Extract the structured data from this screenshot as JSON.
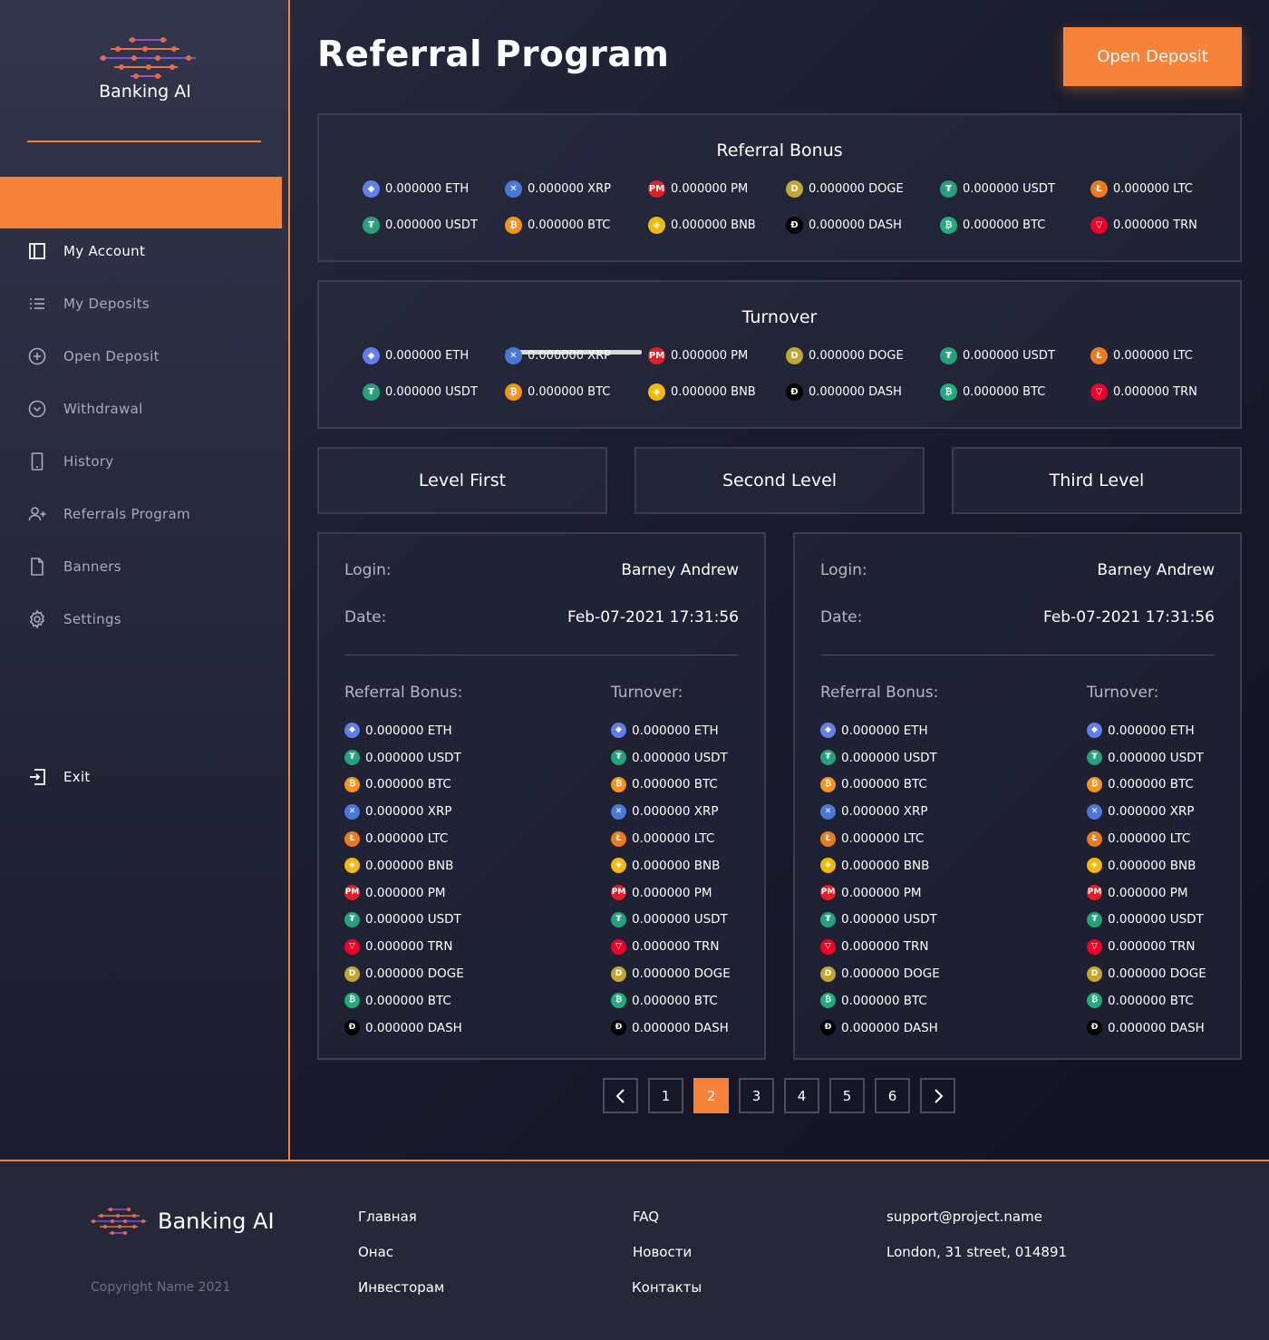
{
  "brand": {
    "name": "Banking AI"
  },
  "sidebar": {
    "items": [
      {
        "label": "My Account",
        "icon": "account-panel-icon"
      },
      {
        "label": "My Deposits",
        "icon": "list-icon"
      },
      {
        "label": "Open Deposit",
        "icon": "plus-circle-icon"
      },
      {
        "label": "Withdrawal",
        "icon": "chevron-circle-icon"
      },
      {
        "label": "History",
        "icon": "phone-icon"
      },
      {
        "label": "Referrals Program",
        "icon": "add-user-icon"
      },
      {
        "label": "Banners",
        "icon": "document-icon"
      },
      {
        "label": "Settings",
        "icon": "gear-icon"
      }
    ],
    "exit": {
      "label": "Exit",
      "icon": "exit-icon"
    }
  },
  "header": {
    "title": "Referral Program",
    "open_deposit": "Open Deposit"
  },
  "colors": {
    "accent": "#f7823a",
    "background": "#191b2c",
    "panel_border": "#3b3d52"
  },
  "coins": {
    "ETH": {
      "bg": "#627eea",
      "glyph": "◆"
    },
    "XRP": {
      "bg": "#4a78d6",
      "glyph": "✕"
    },
    "PM": {
      "bg": "#e21e26",
      "glyph": "PM"
    },
    "DOGE": {
      "bg": "#c3a634",
      "glyph": "D"
    },
    "USDT": {
      "bg": "#26a17b",
      "glyph": "₮"
    },
    "LTC": {
      "bg": "#ee7b1a",
      "glyph": "Ł"
    },
    "BTC": {
      "bg": "#f7931a",
      "glyph": "₿"
    },
    "BNB": {
      "bg": "#f0b90b",
      "glyph": "◈"
    },
    "DASH": {
      "bg": "#000000",
      "glyph": "Đ"
    },
    "BTCG": {
      "bg": "#1fae7a",
      "glyph": "₿"
    },
    "TRN": {
      "bg": "#ef0027",
      "glyph": "▽"
    }
  },
  "referral_bonus": {
    "title": "Referral Bonus",
    "rows": [
      [
        {
          "c": "ETH",
          "t": "0.000000 ETH"
        },
        {
          "c": "XRP",
          "t": "0.000000 XRP"
        },
        {
          "c": "PM",
          "t": "0.000000 PM"
        },
        {
          "c": "DOGE",
          "t": "0.000000 DOGE"
        },
        {
          "c": "USDT",
          "t": "0.000000 USDT"
        },
        {
          "c": "LTC",
          "t": "0.000000 LTC"
        }
      ],
      [
        {
          "c": "USDT",
          "t": "0.000000 USDT"
        },
        {
          "c": "BTC",
          "t": "0.000000 BTC"
        },
        {
          "c": "BNB",
          "t": "0.000000 BNB"
        },
        {
          "c": "DASH",
          "t": "0.000000 DASH"
        },
        {
          "c": "BTCG",
          "t": "0.000000 BTC"
        },
        {
          "c": "TRN",
          "t": "0.000000 TRN"
        }
      ]
    ]
  },
  "turnover": {
    "title": "Turnover",
    "rows": [
      [
        {
          "c": "ETH",
          "t": "0.000000 ETH"
        },
        {
          "c": "XRP",
          "t": "0.000000 XRP"
        },
        {
          "c": "PM",
          "t": "0.000000 PM"
        },
        {
          "c": "DOGE",
          "t": "0.000000 DOGE"
        },
        {
          "c": "USDT",
          "t": "0.000000 USDT"
        },
        {
          "c": "LTC",
          "t": "0.000000 LTC"
        }
      ],
      [
        {
          "c": "USDT",
          "t": "0.000000 USDT"
        },
        {
          "c": "BTC",
          "t": "0.000000 BTC"
        },
        {
          "c": "BNB",
          "t": "0.000000 BNB"
        },
        {
          "c": "DASH",
          "t": "0.000000 DASH"
        },
        {
          "c": "BTCG",
          "t": "0.000000 BTC"
        },
        {
          "c": "TRN",
          "t": "0.000000 TRN"
        }
      ]
    ]
  },
  "levels": [
    "Level First",
    "Second Level",
    "Third Level"
  ],
  "cards": [
    {
      "login_label": "Login:",
      "login": "Barney Andrew",
      "date_label": "Date:",
      "date": "Feb-07-2021 17:31:56",
      "bonus_label": "Referral Bonus:",
      "turnover_label": "Turnover:"
    },
    {
      "login_label": "Login:",
      "login": "Barney Andrew",
      "date_label": "Date:",
      "date": "Feb-07-2021 17:31:56",
      "bonus_label": "Referral Bonus:",
      "turnover_label": "Turnover:"
    }
  ],
  "card_coins": [
    {
      "c": "ETH",
      "t": "0.000000 ETH"
    },
    {
      "c": "USDT",
      "t": "0.000000 USDT"
    },
    {
      "c": "BTC",
      "t": "0.000000 BTC"
    },
    {
      "c": "XRP",
      "t": "0.000000 XRP"
    },
    {
      "c": "LTC",
      "t": "0.000000 LTC"
    },
    {
      "c": "BNB",
      "t": "0.000000 BNB"
    },
    {
      "c": "PM",
      "t": "0.000000 PM"
    },
    {
      "c": "USDT",
      "t": "0.000000 USDT"
    },
    {
      "c": "TRN",
      "t": "0.000000 TRN"
    },
    {
      "c": "DOGE",
      "t": "0.000000 DOGE"
    },
    {
      "c": "BTCG",
      "t": "0.000000 BTC"
    },
    {
      "c": "DASH",
      "t": "0.000000 DASH"
    }
  ],
  "pagination": {
    "pages": [
      "1",
      "2",
      "3",
      "4",
      "5",
      "6"
    ],
    "current": "2"
  },
  "footer": {
    "brand": "Banking AI",
    "copyright": "Copyright Name 2021",
    "col1": [
      "Главная",
      "Онас",
      "Инвесторам"
    ],
    "col2": [
      "FAQ",
      "Новости",
      "Контакты"
    ],
    "email": "support@project.name",
    "address": "London, 31 street, 014891"
  }
}
